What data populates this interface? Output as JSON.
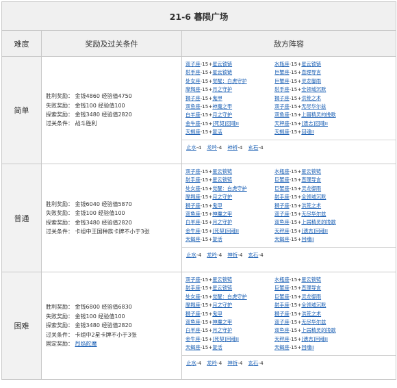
{
  "title": "21-6 暮陨广场",
  "headers": {
    "difficulty": "难度",
    "reward": "奖励及过关条件",
    "enemy": "敌方阵容"
  },
  "rows": [
    {
      "difficulty": "简单",
      "reward_lines": [
        {
          "label": "胜利奖励：",
          "value": "金钱4860 经验值4750"
        },
        {
          "label": "失败奖励：",
          "value": "金钱100 经验值100"
        },
        {
          "label": "探索奖励：",
          "value": "金钱3480 经验值2820"
        },
        {
          "label": "过关条件：",
          "value": "战斗胜利"
        }
      ],
      "enemies_left": [
        {
          "name": "双子座",
          "level": "-15+",
          "skill": "星云锁链"
        },
        {
          "name": "射手座",
          "level": "-15+",
          "skill": "星云锁链"
        },
        {
          "name": "处女座",
          "level": "-15+",
          "skill": "觉醒：白虎守护"
        },
        {
          "name": "摩羯座",
          "level": "-15+",
          "skill": "月之守护"
        },
        {
          "name": "狮子座",
          "level": "-15+",
          "skill": "鬼甲"
        },
        {
          "name": "双鱼座",
          "level": "-15+",
          "skill": "神魔之甲"
        },
        {
          "name": "白羊座",
          "level": "-15+",
          "skill": "月之守护"
        },
        {
          "name": "金牛座",
          "level": "-15+",
          "skill": "[死契]回魂II"
        },
        {
          "name": "天蝎座",
          "level": "-15+",
          "skill": "复活"
        }
      ],
      "enemies_right": [
        {
          "name": "水瓶座",
          "level": "-15+",
          "skill": "星云锁链"
        },
        {
          "name": "巨蟹座",
          "level": "-15+",
          "skill": "直理导言"
        },
        {
          "name": "巨蟹座",
          "level": "-15+",
          "skill": "灵龙御雨"
        },
        {
          "name": "射手座",
          "level": "-15+",
          "skill": "全领域沉默"
        },
        {
          "name": "狮子座",
          "level": "-15+",
          "skill": "洪荒之术"
        },
        {
          "name": "双子座",
          "level": "-15+",
          "skill": "无尽华尔兹"
        },
        {
          "name": "双鱼座",
          "level": "-15+",
          "skill": "上届精灵的挽歌"
        },
        {
          "name": "天秤座",
          "level": "-15+",
          "skill": "[遗志]回魂II"
        },
        {
          "name": "天蝎座",
          "level": "-15+",
          "skill": "回魂II"
        }
      ],
      "items": [
        {
          "name": "止水",
          "count": "-4"
        },
        {
          "name": "龙吟",
          "count": "-4"
        },
        {
          "name": "神祈",
          "count": "-4"
        },
        {
          "name": "玄石",
          "count": "-4"
        }
      ]
    },
    {
      "difficulty": "普通",
      "reward_lines": [
        {
          "label": "胜利奖励：",
          "value": "金钱6040 经验值5870"
        },
        {
          "label": "失败奖励：",
          "value": "金钱100 经验值100"
        },
        {
          "label": "探索奖励：",
          "value": "金钱3480 经验值2820"
        },
        {
          "label": "过关条件：",
          "value": "卡组中王国种族卡牌不小于3张"
        }
      ],
      "enemies_left": [
        {
          "name": "双子座",
          "level": "-15+",
          "skill": "星云锁链"
        },
        {
          "name": "射手座",
          "level": "-15+",
          "skill": "星云锁链"
        },
        {
          "name": "处女座",
          "level": "-15+",
          "skill": "觉醒：白虎守护"
        },
        {
          "name": "摩羯座",
          "level": "-15+",
          "skill": "月之守护"
        },
        {
          "name": "狮子座",
          "level": "-15+",
          "skill": "鬼甲"
        },
        {
          "name": "双鱼座",
          "level": "-15+",
          "skill": "神魔之甲"
        },
        {
          "name": "白羊座",
          "level": "-15+",
          "skill": "月之守护"
        },
        {
          "name": "金牛座",
          "level": "-15+",
          "skill": "[死契]回魂II"
        },
        {
          "name": "天蝎座",
          "level": "-15+",
          "skill": "复活"
        }
      ],
      "enemies_right": [
        {
          "name": "水瓶座",
          "level": "-15+",
          "skill": "星云锁链"
        },
        {
          "name": "巨蟹座",
          "level": "-15+",
          "skill": "直理导言"
        },
        {
          "name": "巨蟹座",
          "level": "-15+",
          "skill": "灵龙御雨"
        },
        {
          "name": "射手座",
          "level": "-15+",
          "skill": "全领域沉默"
        },
        {
          "name": "狮子座",
          "level": "-15+",
          "skill": "洪荒之术"
        },
        {
          "name": "双子座",
          "level": "-15+",
          "skill": "无尽华尔兹"
        },
        {
          "name": "双鱼座",
          "level": "-15+",
          "skill": "上届精灵的挽歌"
        },
        {
          "name": "天秤座",
          "level": "-15+",
          "skill": "[遗志]回魂II"
        },
        {
          "name": "天蝎座",
          "level": "-15+",
          "skill": "回魂II"
        }
      ],
      "items": [
        {
          "name": "止水",
          "count": "-4"
        },
        {
          "name": "龙吟",
          "count": "-4"
        },
        {
          "name": "神祈",
          "count": "-4"
        },
        {
          "name": "玄石",
          "count": "-4"
        }
      ]
    },
    {
      "difficulty": "困难",
      "reward_lines": [
        {
          "label": "胜利奖励：",
          "value": "金钱6800 经验值6830"
        },
        {
          "label": "失败奖励：",
          "value": "金钱100 经验值100"
        },
        {
          "label": "探索奖励：",
          "value": "金钱3480 经验值2820"
        },
        {
          "label": "过关条件：",
          "value": "卡组中2星卡牌不小于3张"
        },
        {
          "label": "固定奖励：",
          "value": "烈焰舵魔",
          "link": true
        }
      ],
      "enemies_left": [
        {
          "name": "双子座",
          "level": "-15+",
          "skill": "星云锁链"
        },
        {
          "name": "射手座",
          "level": "-15+",
          "skill": "星云锁链"
        },
        {
          "name": "处女座",
          "level": "-15+",
          "skill": "觉醒：白虎守护"
        },
        {
          "name": "摩羯座",
          "level": "-15+",
          "skill": "月之守护"
        },
        {
          "name": "狮子座",
          "level": "-15+",
          "skill": "鬼甲"
        },
        {
          "name": "双鱼座",
          "level": "-15+",
          "skill": "神魔之甲"
        },
        {
          "name": "白羊座",
          "level": "-15+",
          "skill": "月之守护"
        },
        {
          "name": "金牛座",
          "level": "-15+",
          "skill": "[死契]回魂II"
        },
        {
          "name": "天蝎座",
          "level": "-15+",
          "skill": "复活"
        }
      ],
      "enemies_right": [
        {
          "name": "水瓶座",
          "level": "-15+",
          "skill": "星云锁链"
        },
        {
          "name": "巨蟹座",
          "level": "-15+",
          "skill": "直理导言"
        },
        {
          "name": "巨蟹座",
          "level": "-15+",
          "skill": "灵龙御雨"
        },
        {
          "name": "射手座",
          "level": "-15+",
          "skill": "全领域沉默"
        },
        {
          "name": "狮子座",
          "level": "-15+",
          "skill": "洪荒之术"
        },
        {
          "name": "双子座",
          "level": "-15+",
          "skill": "无尽华尔兹"
        },
        {
          "name": "双鱼座",
          "level": "-15+",
          "skill": "上届精灵的挽歌"
        },
        {
          "name": "天秤座",
          "level": "-15+",
          "skill": "[遗志]回魂II"
        },
        {
          "name": "天蝎座",
          "level": "-15+",
          "skill": "回魂II"
        }
      ],
      "items": [
        {
          "name": "止水",
          "count": "-4"
        },
        {
          "name": "龙吟",
          "count": "-4"
        },
        {
          "name": "神祈",
          "count": "-4"
        },
        {
          "name": "玄石",
          "count": "-4"
        }
      ]
    }
  ]
}
